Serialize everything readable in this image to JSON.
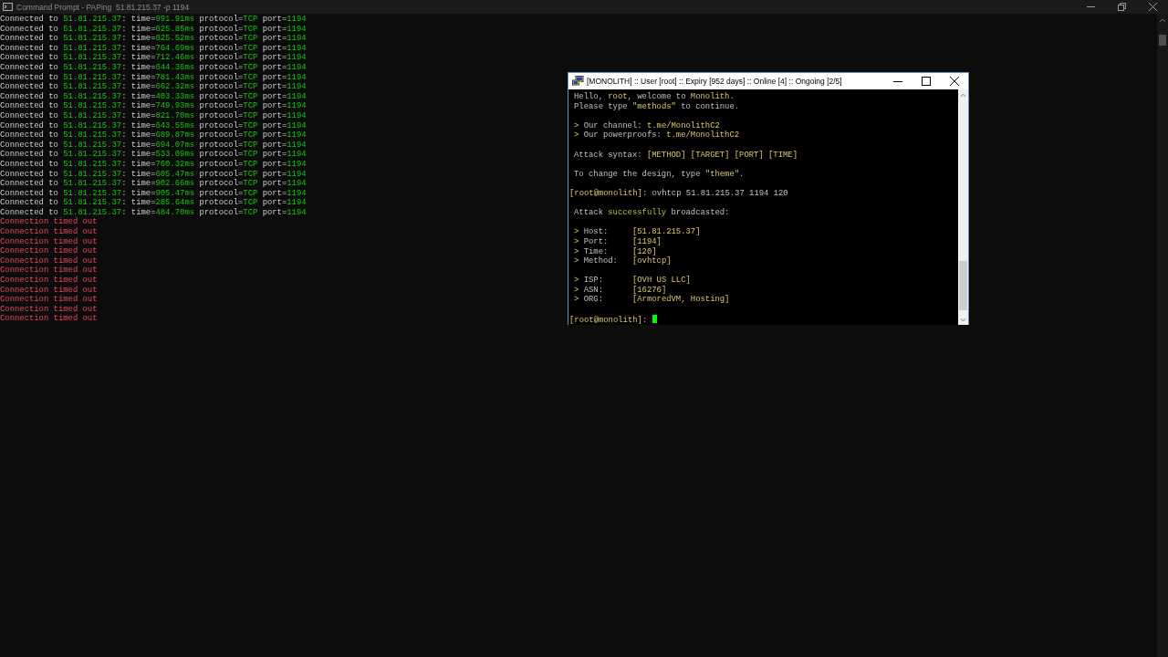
{
  "console": {
    "title": "Command Prompt - PAPing  51.81.215.37 -p 1194",
    "lines": [
      {
        "kind": "reply",
        "segments": [
          {
            "kind": "plain",
            "text": "Connected to "
          },
          {
            "kind": "value",
            "text": "51.81.215.37"
          },
          {
            "kind": "plain",
            "text": ": time="
          },
          {
            "kind": "value",
            "text": "991.91ms"
          },
          {
            "kind": "plain",
            "text": " protocol="
          },
          {
            "kind": "value",
            "text": "TCP"
          },
          {
            "kind": "plain",
            "text": " port="
          },
          {
            "kind": "value",
            "text": "1194"
          }
        ]
      },
      {
        "kind": "reply",
        "segments": [
          {
            "kind": "plain",
            "text": "Connected to "
          },
          {
            "kind": "value",
            "text": "51.81.215.37"
          },
          {
            "kind": "plain",
            "text": ": time="
          },
          {
            "kind": "value",
            "text": "625.85ms"
          },
          {
            "kind": "plain",
            "text": " protocol="
          },
          {
            "kind": "value",
            "text": "TCP"
          },
          {
            "kind": "plain",
            "text": " port="
          },
          {
            "kind": "value",
            "text": "1194"
          }
        ]
      },
      {
        "kind": "reply",
        "segments": [
          {
            "kind": "plain",
            "text": "Connected to "
          },
          {
            "kind": "value",
            "text": "51.81.215.37"
          },
          {
            "kind": "plain",
            "text": ": time="
          },
          {
            "kind": "value",
            "text": "625.52ms"
          },
          {
            "kind": "plain",
            "text": " protocol="
          },
          {
            "kind": "value",
            "text": "TCP"
          },
          {
            "kind": "plain",
            "text": " port="
          },
          {
            "kind": "value",
            "text": "1194"
          }
        ]
      },
      {
        "kind": "reply",
        "segments": [
          {
            "kind": "plain",
            "text": "Connected to "
          },
          {
            "kind": "value",
            "text": "51.81.215.37"
          },
          {
            "kind": "plain",
            "text": ": time="
          },
          {
            "kind": "value",
            "text": "764.69ms"
          },
          {
            "kind": "plain",
            "text": " protocol="
          },
          {
            "kind": "value",
            "text": "TCP"
          },
          {
            "kind": "plain",
            "text": " port="
          },
          {
            "kind": "value",
            "text": "1194"
          }
        ]
      },
      {
        "kind": "reply",
        "segments": [
          {
            "kind": "plain",
            "text": "Connected to "
          },
          {
            "kind": "value",
            "text": "51.81.215.37"
          },
          {
            "kind": "plain",
            "text": ": time="
          },
          {
            "kind": "value",
            "text": "712.46ms"
          },
          {
            "kind": "plain",
            "text": " protocol="
          },
          {
            "kind": "value",
            "text": "TCP"
          },
          {
            "kind": "plain",
            "text": " port="
          },
          {
            "kind": "value",
            "text": "1194"
          }
        ]
      },
      {
        "kind": "reply",
        "segments": [
          {
            "kind": "plain",
            "text": "Connected to "
          },
          {
            "kind": "value",
            "text": "51.81.215.37"
          },
          {
            "kind": "plain",
            "text": ": time="
          },
          {
            "kind": "value",
            "text": "644.36ms"
          },
          {
            "kind": "plain",
            "text": " protocol="
          },
          {
            "kind": "value",
            "text": "TCP"
          },
          {
            "kind": "plain",
            "text": " port="
          },
          {
            "kind": "value",
            "text": "1194"
          }
        ]
      },
      {
        "kind": "reply",
        "segments": [
          {
            "kind": "plain",
            "text": "Connected to "
          },
          {
            "kind": "value",
            "text": "51.81.215.37"
          },
          {
            "kind": "plain",
            "text": ": time="
          },
          {
            "kind": "value",
            "text": "781.43ms"
          },
          {
            "kind": "plain",
            "text": " protocol="
          },
          {
            "kind": "value",
            "text": "TCP"
          },
          {
            "kind": "plain",
            "text": " port="
          },
          {
            "kind": "value",
            "text": "1194"
          }
        ]
      },
      {
        "kind": "reply",
        "segments": [
          {
            "kind": "plain",
            "text": "Connected to "
          },
          {
            "kind": "value",
            "text": "51.81.215.37"
          },
          {
            "kind": "plain",
            "text": ": time="
          },
          {
            "kind": "value",
            "text": "662.32ms"
          },
          {
            "kind": "plain",
            "text": " protocol="
          },
          {
            "kind": "value",
            "text": "TCP"
          },
          {
            "kind": "plain",
            "text": " port="
          },
          {
            "kind": "value",
            "text": "1194"
          }
        ]
      },
      {
        "kind": "reply",
        "segments": [
          {
            "kind": "plain",
            "text": "Connected to "
          },
          {
            "kind": "value",
            "text": "51.81.215.37"
          },
          {
            "kind": "plain",
            "text": ": time="
          },
          {
            "kind": "value",
            "text": "403.33ms"
          },
          {
            "kind": "plain",
            "text": " protocol="
          },
          {
            "kind": "value",
            "text": "TCP"
          },
          {
            "kind": "plain",
            "text": " port="
          },
          {
            "kind": "value",
            "text": "1194"
          }
        ]
      },
      {
        "kind": "reply",
        "segments": [
          {
            "kind": "plain",
            "text": "Connected to "
          },
          {
            "kind": "value",
            "text": "51.81.215.37"
          },
          {
            "kind": "plain",
            "text": ": time="
          },
          {
            "kind": "value",
            "text": "749.93ms"
          },
          {
            "kind": "plain",
            "text": " protocol="
          },
          {
            "kind": "value",
            "text": "TCP"
          },
          {
            "kind": "plain",
            "text": " port="
          },
          {
            "kind": "value",
            "text": "1194"
          }
        ]
      },
      {
        "kind": "reply",
        "segments": [
          {
            "kind": "plain",
            "text": "Connected to "
          },
          {
            "kind": "value",
            "text": "51.81.215.37"
          },
          {
            "kind": "plain",
            "text": ": time="
          },
          {
            "kind": "value",
            "text": "821.70ms"
          },
          {
            "kind": "plain",
            "text": " protocol="
          },
          {
            "kind": "value",
            "text": "TCP"
          },
          {
            "kind": "plain",
            "text": " port="
          },
          {
            "kind": "value",
            "text": "1194"
          }
        ]
      },
      {
        "kind": "reply",
        "segments": [
          {
            "kind": "plain",
            "text": "Connected to "
          },
          {
            "kind": "value",
            "text": "51.81.215.37"
          },
          {
            "kind": "plain",
            "text": ": time="
          },
          {
            "kind": "value",
            "text": "643.55ms"
          },
          {
            "kind": "plain",
            "text": " protocol="
          },
          {
            "kind": "value",
            "text": "TCP"
          },
          {
            "kind": "plain",
            "text": " port="
          },
          {
            "kind": "value",
            "text": "1194"
          }
        ]
      },
      {
        "kind": "reply",
        "segments": [
          {
            "kind": "plain",
            "text": "Connected to "
          },
          {
            "kind": "value",
            "text": "51.81.215.37"
          },
          {
            "kind": "plain",
            "text": ": time="
          },
          {
            "kind": "value",
            "text": "689.87ms"
          },
          {
            "kind": "plain",
            "text": " protocol="
          },
          {
            "kind": "value",
            "text": "TCP"
          },
          {
            "kind": "plain",
            "text": " port="
          },
          {
            "kind": "value",
            "text": "1194"
          }
        ]
      },
      {
        "kind": "reply",
        "segments": [
          {
            "kind": "plain",
            "text": "Connected to "
          },
          {
            "kind": "value",
            "text": "51.81.215.37"
          },
          {
            "kind": "plain",
            "text": ": time="
          },
          {
            "kind": "value",
            "text": "694.07ms"
          },
          {
            "kind": "plain",
            "text": " protocol="
          },
          {
            "kind": "value",
            "text": "TCP"
          },
          {
            "kind": "plain",
            "text": " port="
          },
          {
            "kind": "value",
            "text": "1194"
          }
        ]
      },
      {
        "kind": "reply",
        "segments": [
          {
            "kind": "plain",
            "text": "Connected to "
          },
          {
            "kind": "value",
            "text": "51.81.215.37"
          },
          {
            "kind": "plain",
            "text": ": time="
          },
          {
            "kind": "value",
            "text": "533.09ms"
          },
          {
            "kind": "plain",
            "text": " protocol="
          },
          {
            "kind": "value",
            "text": "TCP"
          },
          {
            "kind": "plain",
            "text": " port="
          },
          {
            "kind": "value",
            "text": "1194"
          }
        ]
      },
      {
        "kind": "reply",
        "segments": [
          {
            "kind": "plain",
            "text": "Connected to "
          },
          {
            "kind": "value",
            "text": "51.81.215.37"
          },
          {
            "kind": "plain",
            "text": ": time="
          },
          {
            "kind": "value",
            "text": "760.32ms"
          },
          {
            "kind": "plain",
            "text": " protocol="
          },
          {
            "kind": "value",
            "text": "TCP"
          },
          {
            "kind": "plain",
            "text": " port="
          },
          {
            "kind": "value",
            "text": "1194"
          }
        ]
      },
      {
        "kind": "reply",
        "segments": [
          {
            "kind": "plain",
            "text": "Connected to "
          },
          {
            "kind": "value",
            "text": "51.81.215.37"
          },
          {
            "kind": "plain",
            "text": ": time="
          },
          {
            "kind": "value",
            "text": "605.47ms"
          },
          {
            "kind": "plain",
            "text": " protocol="
          },
          {
            "kind": "value",
            "text": "TCP"
          },
          {
            "kind": "plain",
            "text": " port="
          },
          {
            "kind": "value",
            "text": "1194"
          }
        ]
      },
      {
        "kind": "reply",
        "segments": [
          {
            "kind": "plain",
            "text": "Connected to "
          },
          {
            "kind": "value",
            "text": "51.81.215.37"
          },
          {
            "kind": "plain",
            "text": ": time="
          },
          {
            "kind": "value",
            "text": "902.66ms"
          },
          {
            "kind": "plain",
            "text": " protocol="
          },
          {
            "kind": "value",
            "text": "TCP"
          },
          {
            "kind": "plain",
            "text": " port="
          },
          {
            "kind": "value",
            "text": "1194"
          }
        ]
      },
      {
        "kind": "reply",
        "segments": [
          {
            "kind": "plain",
            "text": "Connected to "
          },
          {
            "kind": "value",
            "text": "51.81.215.37"
          },
          {
            "kind": "plain",
            "text": ": time="
          },
          {
            "kind": "value",
            "text": "905.47ms"
          },
          {
            "kind": "plain",
            "text": " protocol="
          },
          {
            "kind": "value",
            "text": "TCP"
          },
          {
            "kind": "plain",
            "text": " port="
          },
          {
            "kind": "value",
            "text": "1194"
          }
        ]
      },
      {
        "kind": "reply",
        "segments": [
          {
            "kind": "plain",
            "text": "Connected to "
          },
          {
            "kind": "value",
            "text": "51.81.215.37"
          },
          {
            "kind": "plain",
            "text": ": time="
          },
          {
            "kind": "value",
            "text": "285.64ms"
          },
          {
            "kind": "plain",
            "text": " protocol="
          },
          {
            "kind": "value",
            "text": "TCP"
          },
          {
            "kind": "plain",
            "text": " port="
          },
          {
            "kind": "value",
            "text": "1194"
          }
        ]
      },
      {
        "kind": "reply",
        "segments": [
          {
            "kind": "plain",
            "text": "Connected to "
          },
          {
            "kind": "value",
            "text": "51.81.215.37"
          },
          {
            "kind": "plain",
            "text": ": time="
          },
          {
            "kind": "value",
            "text": "484.70ms"
          },
          {
            "kind": "plain",
            "text": " protocol="
          },
          {
            "kind": "value",
            "text": "TCP"
          },
          {
            "kind": "plain",
            "text": " port="
          },
          {
            "kind": "value",
            "text": "1194"
          }
        ]
      },
      {
        "kind": "error",
        "segments": [
          {
            "kind": "error",
            "text": "Connection timed out"
          }
        ]
      },
      {
        "kind": "error",
        "segments": [
          {
            "kind": "error",
            "text": "Connection timed out"
          }
        ]
      },
      {
        "kind": "error",
        "segments": [
          {
            "kind": "error",
            "text": "Connection timed out"
          }
        ]
      },
      {
        "kind": "error",
        "segments": [
          {
            "kind": "error",
            "text": "Connection timed out"
          }
        ]
      },
      {
        "kind": "error",
        "segments": [
          {
            "kind": "error",
            "text": "Connection timed out"
          }
        ]
      },
      {
        "kind": "error",
        "segments": [
          {
            "kind": "error",
            "text": "Connection timed out"
          }
        ]
      },
      {
        "kind": "error",
        "segments": [
          {
            "kind": "error",
            "text": "Connection timed out"
          }
        ]
      },
      {
        "kind": "error",
        "segments": [
          {
            "kind": "error",
            "text": "Connection timed out"
          }
        ]
      },
      {
        "kind": "error",
        "segments": [
          {
            "kind": "error",
            "text": "Connection timed out"
          }
        ]
      },
      {
        "kind": "error",
        "segments": [
          {
            "kind": "error",
            "text": "Connection timed out"
          }
        ]
      },
      {
        "kind": "error",
        "segments": [
          {
            "kind": "error",
            "text": "Connection timed out"
          }
        ]
      }
    ]
  },
  "terminal": {
    "title": "[MONOLITH] :: User [root] :: Expiry [952 days] :: Online [4] :: Ongoing [2/5]",
    "lines": [
      {
        "indented": true,
        "spaced": false,
        "segments": [
          {
            "kind": "plain",
            "text": "Hello, "
          },
          {
            "kind": "hl",
            "text": "root"
          },
          {
            "kind": "plain",
            "text": ", welcome to "
          },
          {
            "kind": "hl",
            "text": "Monolith"
          },
          {
            "kind": "plain",
            "text": "."
          }
        ]
      },
      {
        "indented": true,
        "spaced": false,
        "segments": [
          {
            "kind": "plain",
            "text": "Please type "
          },
          {
            "kind": "hl",
            "text": "\"methods\""
          },
          {
            "kind": "plain",
            "text": " to continue."
          }
        ]
      },
      {
        "indented": true,
        "spaced": true,
        "segments": [
          {
            "kind": "hl",
            "text": "> "
          },
          {
            "kind": "plain",
            "text": "Our channel: "
          },
          {
            "kind": "hl",
            "text": "t.me/MonolithC2"
          }
        ]
      },
      {
        "indented": true,
        "spaced": false,
        "segments": [
          {
            "kind": "hl",
            "text": "> "
          },
          {
            "kind": "plain",
            "text": "Our powerproofs: "
          },
          {
            "kind": "hl",
            "text": "t.me/MonolithC2"
          }
        ]
      },
      {
        "indented": true,
        "spaced": true,
        "segments": [
          {
            "kind": "plain",
            "text": "Attack syntax: "
          },
          {
            "kind": "hl",
            "text": "[METHOD] [TARGET] [PORT] [TIME]"
          }
        ]
      },
      {
        "indented": true,
        "spaced": true,
        "segments": [
          {
            "kind": "plain",
            "text": "To change the design, type "
          },
          {
            "kind": "hl",
            "text": "\"theme\""
          },
          {
            "kind": "plain",
            "text": "."
          }
        ]
      },
      {
        "indented": false,
        "spaced": true,
        "segments": [
          {
            "kind": "hl",
            "text": "[root@monolith]"
          },
          {
            "kind": "plain",
            "text": ": ovhtcp 51.81.215.37 1194 120"
          }
        ]
      },
      {
        "indented": true,
        "spaced": true,
        "segments": [
          {
            "kind": "plain",
            "text": "Attack "
          },
          {
            "kind": "ok",
            "text": "successfully"
          },
          {
            "kind": "plain",
            "text": " broadcasted:"
          }
        ]
      },
      {
        "indented": true,
        "spaced": true,
        "segments": [
          {
            "kind": "hl",
            "text": "> "
          },
          {
            "kind": "plain",
            "text": "Host:     "
          },
          {
            "kind": "hl",
            "text": "[51.81.215.37]"
          }
        ]
      },
      {
        "indented": true,
        "spaced": false,
        "segments": [
          {
            "kind": "hl",
            "text": "> "
          },
          {
            "kind": "plain",
            "text": "Port:     "
          },
          {
            "kind": "hl",
            "text": "[1194]"
          }
        ]
      },
      {
        "indented": true,
        "spaced": false,
        "segments": [
          {
            "kind": "hl",
            "text": "> "
          },
          {
            "kind": "plain",
            "text": "Time:     "
          },
          {
            "kind": "hl",
            "text": "[120]"
          }
        ]
      },
      {
        "indented": true,
        "spaced": false,
        "segments": [
          {
            "kind": "hl",
            "text": "> "
          },
          {
            "kind": "plain",
            "text": "Method:   "
          },
          {
            "kind": "hl",
            "text": "[ovhtcp]"
          }
        ]
      },
      {
        "indented": true,
        "spaced": true,
        "segments": [
          {
            "kind": "hl",
            "text": "> "
          },
          {
            "kind": "plain",
            "text": "ISP:      "
          },
          {
            "kind": "hl",
            "text": "[OVH US LLC]"
          }
        ]
      },
      {
        "indented": true,
        "spaced": false,
        "segments": [
          {
            "kind": "hl",
            "text": "> "
          },
          {
            "kind": "plain",
            "text": "ASN:      "
          },
          {
            "kind": "hl",
            "text": "[16276]"
          }
        ]
      },
      {
        "indented": true,
        "spaced": false,
        "segments": [
          {
            "kind": "hl",
            "text": "> "
          },
          {
            "kind": "plain",
            "text": "ORG:      "
          },
          {
            "kind": "hl",
            "text": "[ArmoredVM, Hosting]"
          }
        ]
      },
      {
        "indented": false,
        "spaced": true,
        "cursor": true,
        "segments": [
          {
            "kind": "hl",
            "text": "[root@monolith]"
          },
          {
            "kind": "plain",
            "text": ": "
          }
        ]
      }
    ]
  }
}
